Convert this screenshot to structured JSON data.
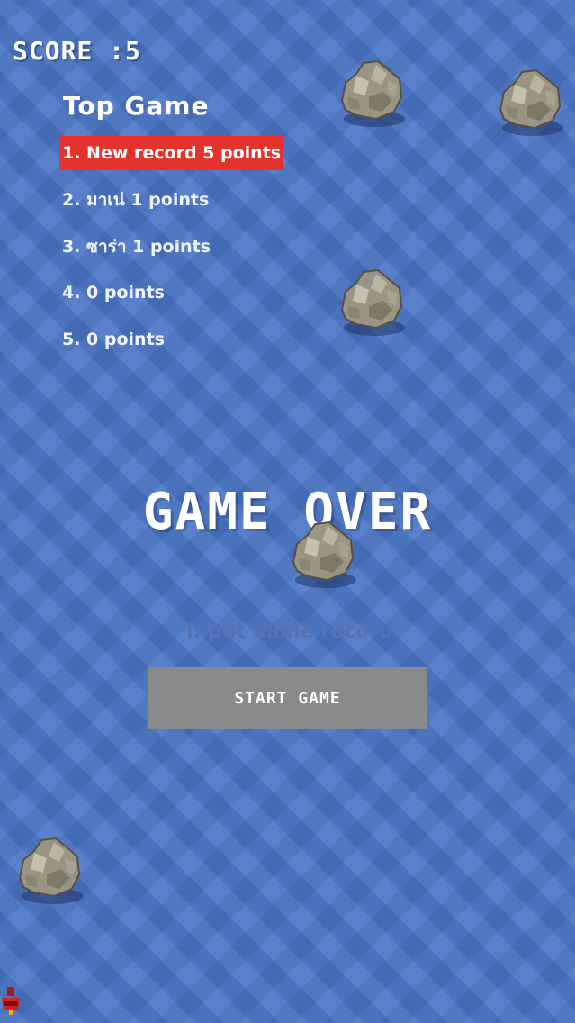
{
  "hud": {
    "score": "SCORE :5"
  },
  "leaderboard": {
    "title": "Top Game",
    "entries": [
      {
        "text": "1. New record 5 points",
        "highlight": true
      },
      {
        "text": "2. มาเน่ 1 points",
        "highlight": false
      },
      {
        "text": "3. ซาร่า 1 points",
        "highlight": false
      },
      {
        "text": "4.   0 points",
        "highlight": false
      },
      {
        "text": "5.   0 points",
        "highlight": false
      }
    ]
  },
  "game_over": {
    "text": "GAME OVER"
  },
  "name_input": {
    "placeholder": "Input name record",
    "value": ""
  },
  "start_button": {
    "label": "START GAME"
  },
  "sprites": {
    "rock": "rock-icon",
    "player": "player-ship-icon"
  },
  "colors": {
    "background": "#4a75c6",
    "highlight": "#e4332c",
    "button": "#8a8a8a",
    "text": "#ffffff"
  }
}
